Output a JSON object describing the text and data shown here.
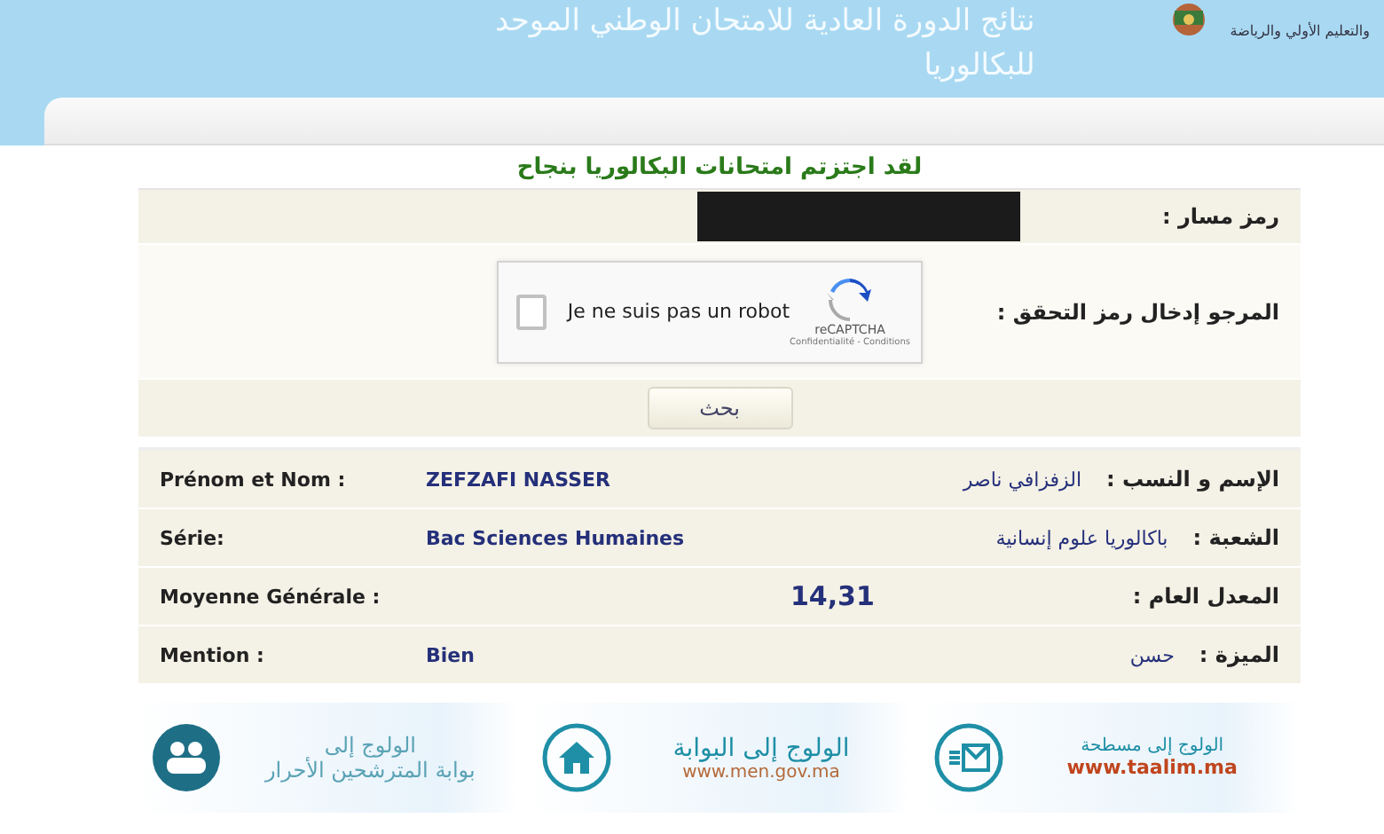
{
  "header": {
    "title_lines": [
      "نتائج الدورة العادية للامتحان الوطني الموحد",
      "للبكالوريا"
    ],
    "ministry_line": "والتعليم الأولي والرياضة"
  },
  "heading": "لقد اجتزتم امتحانات البكالوريا بنجاح",
  "form": {
    "massar_label": "رمز مسار :",
    "massar_redacted": true,
    "captcha_label": "المرجو إدخال رمز التحقق :",
    "captcha": {
      "text": "Je ne suis pas un robot",
      "checked": false,
      "brand": "reCAPTCHA",
      "links": "Confidentialité - Conditions"
    },
    "search_button": "بحث"
  },
  "results": [
    {
      "kind": "paired",
      "fr_label": "Prénom et Nom :",
      "value": "ZEFZAFI NASSER",
      "ar_value": "الزفزافي ناصر",
      "ar_label": "الإسم و النسب :"
    },
    {
      "kind": "paired",
      "fr_label": "Série:",
      "value": "Bac Sciences Humaines",
      "ar_value": "باكالوريا علوم إنسانية",
      "ar_label": "الشعبة :"
    },
    {
      "kind": "single",
      "fr_label": "Moyenne Générale :",
      "value": "14,31",
      "ar_label": "المعدل العام :"
    },
    {
      "kind": "paired",
      "fr_label": "Mention :",
      "value": "Bien",
      "ar_value": "حسن",
      "ar_label": "الميزة :"
    }
  ],
  "banners": [
    {
      "kind": "mail",
      "lines": [
        "الولوج إلى مسطحة",
        "www.taalim.ma"
      ]
    },
    {
      "kind": "home",
      "lines": [
        "الولوج إلى البوابة",
        "www.men.gov.ma"
      ]
    },
    {
      "kind": "people",
      "lines": [
        "الولوج إلى",
        "بوابة المترشحين الأحرار"
      ]
    }
  ]
}
